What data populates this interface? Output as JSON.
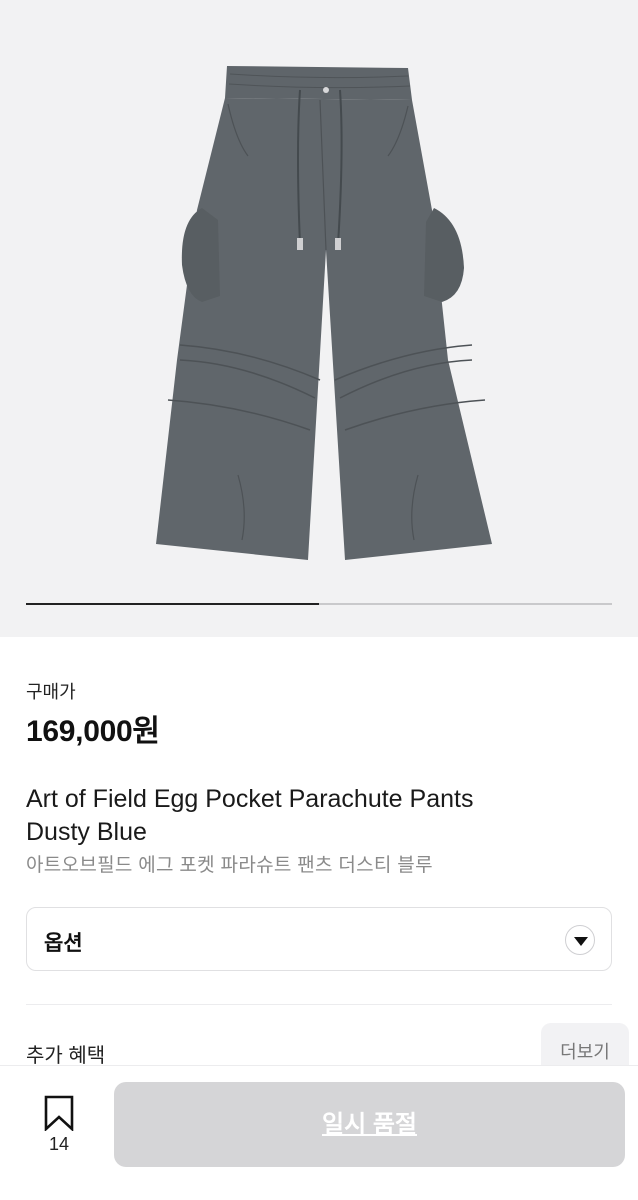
{
  "gallery": {
    "image_alt_icon": "product-photo-cargo-pants",
    "slide_progress": 0.5
  },
  "product": {
    "price_label": "구매가",
    "price": "169,000원",
    "title_en_line1": "Art of Field Egg Pocket Parachute Pants",
    "title_en_line2": "Dusty Blue",
    "title_ko": "아트오브필드 에그 포켓 파라슈트 팬츠 더스티 블루"
  },
  "options": {
    "label": "옵션",
    "icon": "chevron-down-icon"
  },
  "benefits": {
    "label": "추가 혜택",
    "more_label": "더보기"
  },
  "bottom_bar": {
    "bookmark_icon": "bookmark-icon",
    "bookmark_count": "14",
    "cta_label": "일시 품절"
  },
  "colors": {
    "background": "#ffffff",
    "hero_bg": "#f2f2f3",
    "pants_color": "#5e6469",
    "cta_disabled": "#d5d5d7",
    "subtitle_gray": "#8a8a8a"
  }
}
